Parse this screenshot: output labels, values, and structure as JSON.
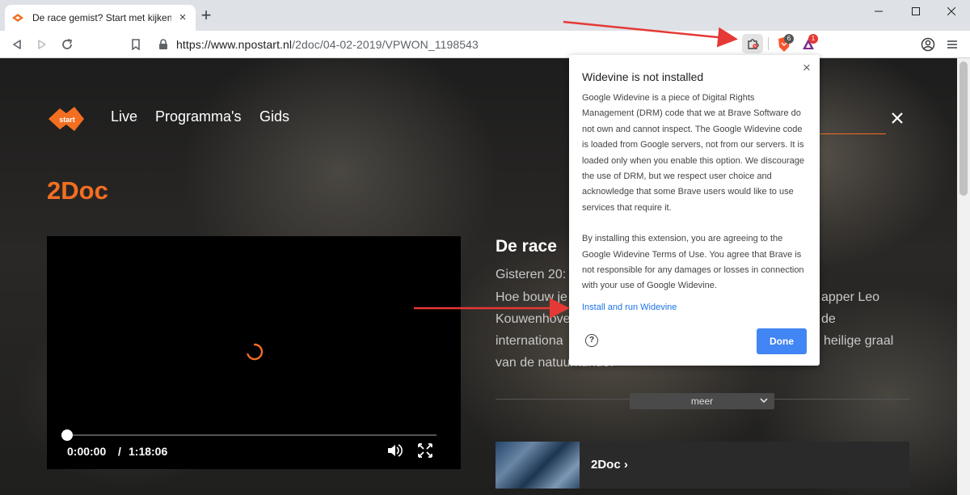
{
  "browser": {
    "tab_title": "De race gemist? Start met kijken op NPO Start",
    "url_main": "https://www.npostart.nl",
    "url_path": "/2doc/04-02-2019/VPWON_1198543",
    "brave_badge": "6",
    "rewards_badge": "1"
  },
  "site": {
    "logo_text": "start",
    "nav": [
      "Live",
      "Programma's",
      "Gids"
    ],
    "brand": "2Doc"
  },
  "player": {
    "current_time": "0:00:00",
    "separator": "/",
    "duration": "1:18:06"
  },
  "episode": {
    "title": "De race",
    "lines": [
      "Gisteren 20:",
      "Hoe bouw je",
      "Kouwenhove",
      "internationa",
      "van de natuurkunde."
    ],
    "right_fragments": [
      "apper Leo",
      "de",
      "heilige graal"
    ],
    "more_label": "meer",
    "series_label": "2Doc ›"
  },
  "popup": {
    "title": "Widevine is not installed",
    "paragraph1": "Google Widevine is a piece of Digital Rights Management (DRM) code that we at Brave Software do not own and cannot inspect. The Google Widevine code is loaded from Google servers, not from our servers. It is loaded only when you enable this option. We discourage the use of DRM, but we respect user choice and acknowledge that some Brave users would like to use services that require it.",
    "paragraph2": "By installing this extension, you are agreeing to the Google Widevine Terms of Use. You agree that Brave is not responsible for any damages or losses in connection with your use of Google Widevine.",
    "link": "Install and run Widevine",
    "done": "Done",
    "help": "?"
  },
  "colors": {
    "accent": "#f36e21",
    "link": "#1a73e8",
    "done_button": "#4285f4",
    "annotation_arrow": "#e53935"
  }
}
